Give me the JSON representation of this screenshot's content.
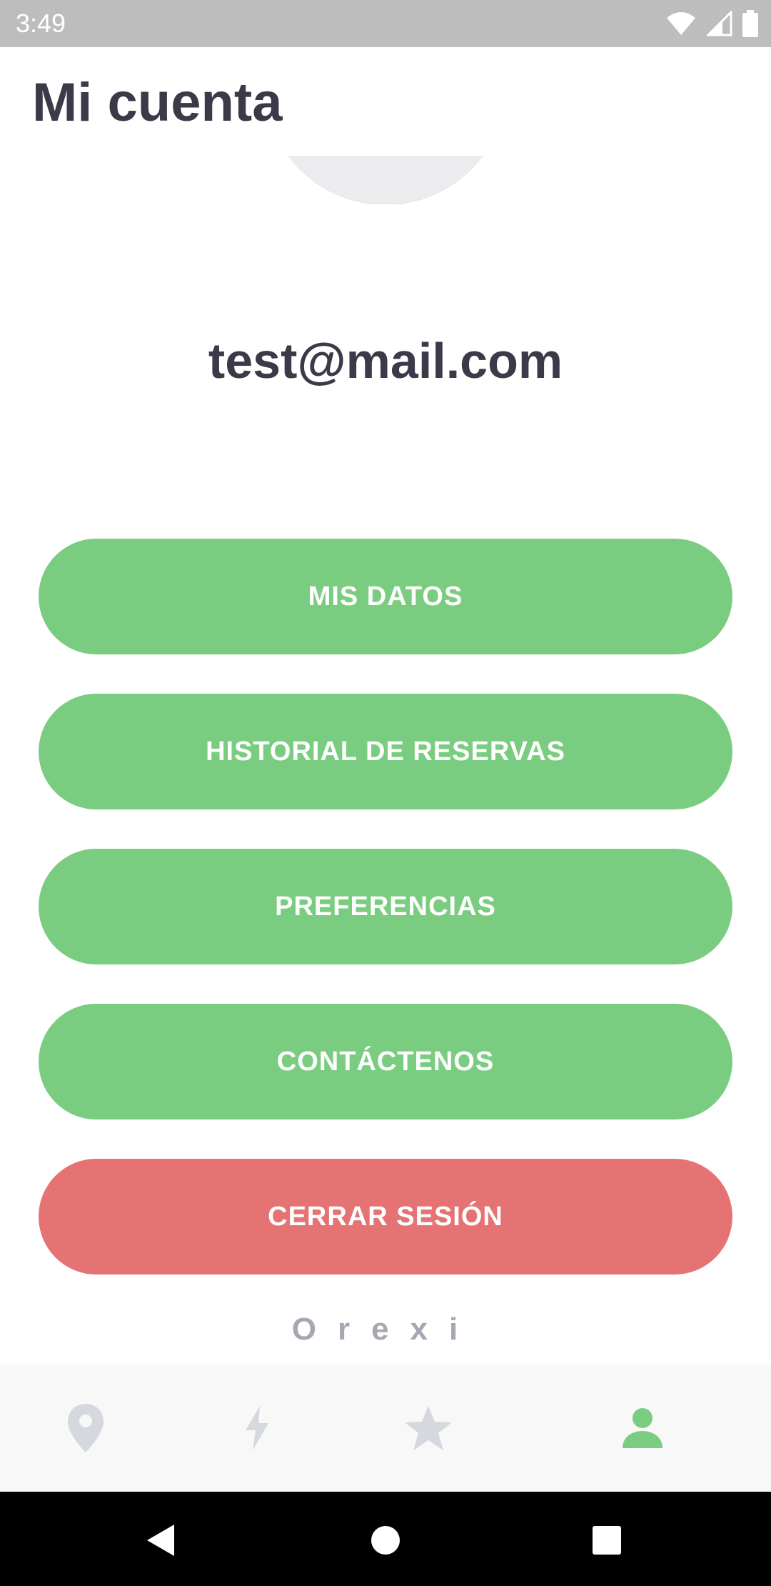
{
  "status_bar": {
    "time": "3:49",
    "icons": [
      "wifi-icon",
      "cell-signal-icon",
      "battery-icon"
    ]
  },
  "header": {
    "title": "Mi cuenta"
  },
  "profile": {
    "email": "test@mail.com"
  },
  "menu": {
    "mis_datos": "MIS DATOS",
    "historial": "HISTORIAL DE RESERVAS",
    "preferencias": "PREFERENCIAS",
    "contactenos": "CONTÁCTENOS",
    "cerrar_sesion": "CERRAR SESIÓN"
  },
  "brand": {
    "name": "Orexi"
  },
  "bottom_nav": {
    "items": [
      "map-pin-icon",
      "bolt-icon",
      "star-icon",
      "person-icon"
    ],
    "active": "person-icon"
  },
  "colors": {
    "accent_green": "#7acd80",
    "danger_red": "#e57373",
    "title_text": "#3a3a48",
    "inactive_icon": "#d6d8e0"
  }
}
